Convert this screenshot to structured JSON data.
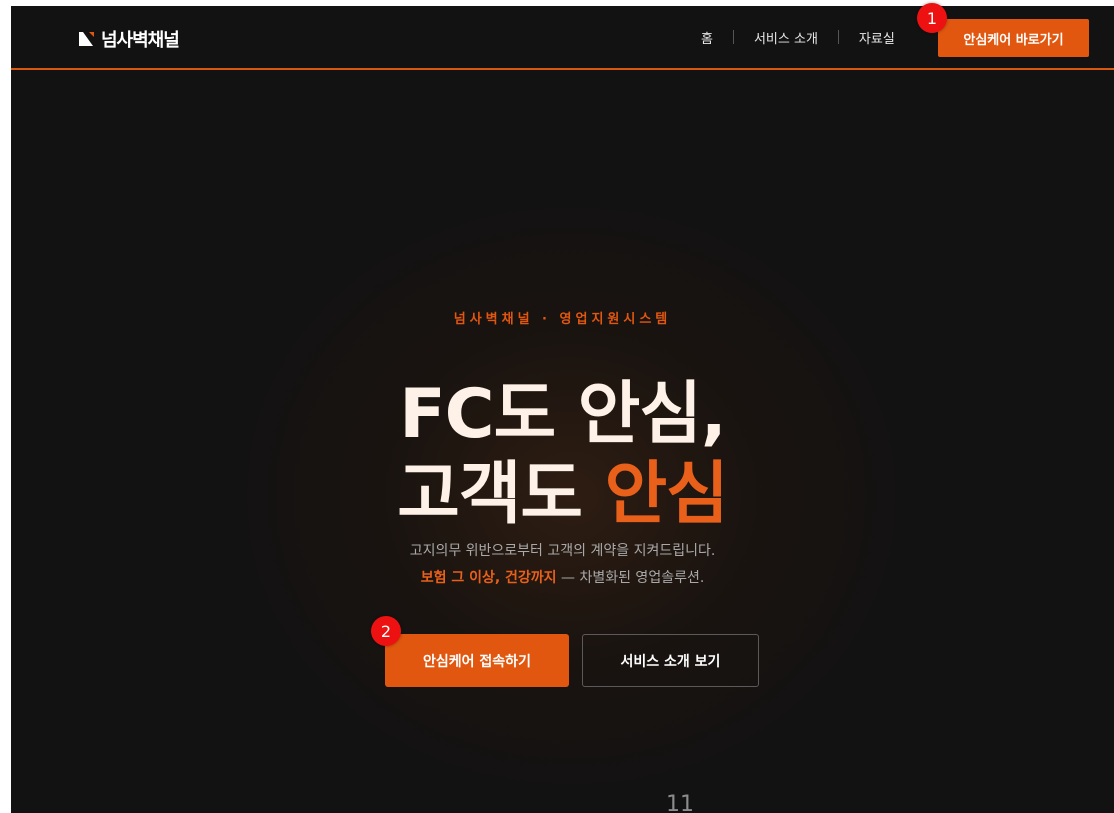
{
  "header": {
    "logo_text": "넘사벽채널",
    "nav": [
      {
        "label": "홈"
      },
      {
        "label": "서비스 소개"
      },
      {
        "label": "자료실"
      }
    ],
    "cta_label": "안심케어 바로가기"
  },
  "hero": {
    "eyebrow": "넘사벽채널 · 영업지원시스템",
    "headline_line1": "FC도 안심,",
    "headline_line2_prefix": "고객도 ",
    "headline_line2_accent": "안심",
    "sub_line1": "고지의무 위반으로부터 고객의 계약을 지켜드립니다.",
    "sub_line2_highlight": "보험 그 이상, 건강까지",
    "sub_line2_rest": " — 차별화된 영업솔루션.",
    "primary_button": "안심케어 접속하기",
    "secondary_button": "서비스 소개 보기"
  },
  "markers": {
    "m1": "1",
    "m2": "2"
  },
  "footer_number": "11",
  "colors": {
    "accent": "#e2570f",
    "background": "#121212"
  }
}
